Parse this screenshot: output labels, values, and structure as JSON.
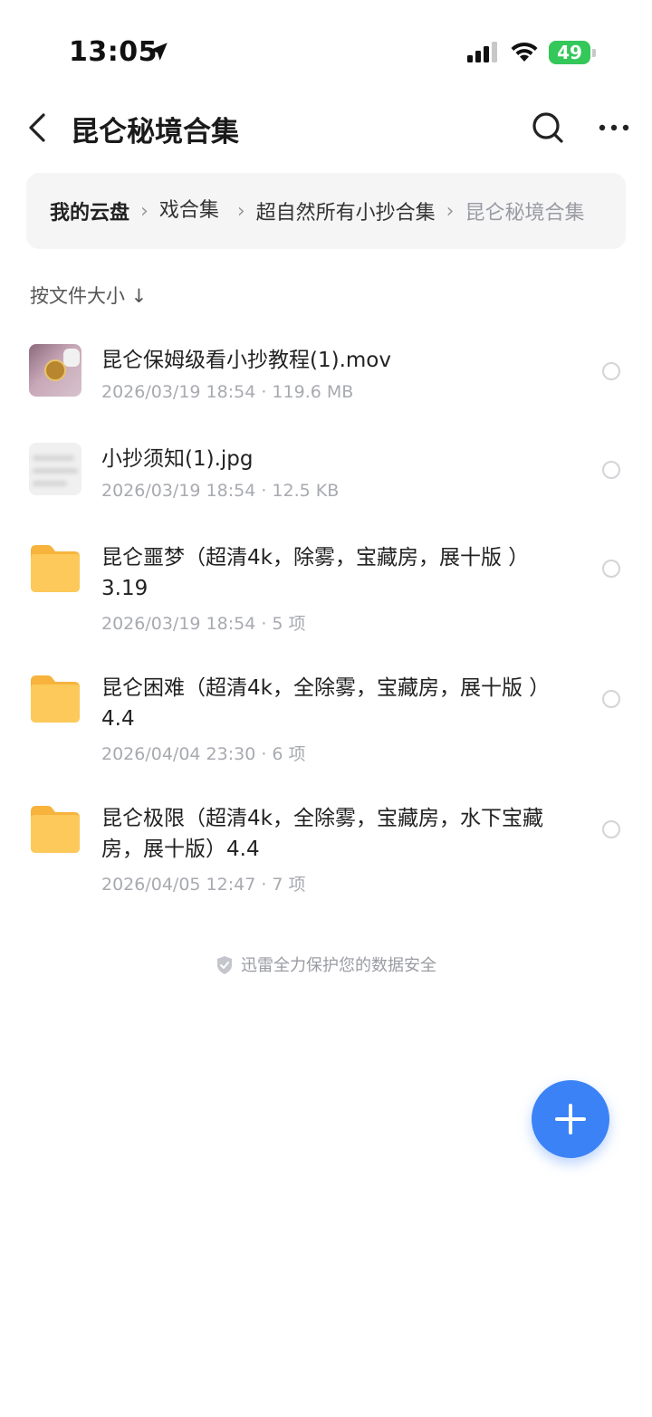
{
  "status_bar": {
    "time": "13:05",
    "battery": "49"
  },
  "header": {
    "title": "昆仑秘境合集"
  },
  "breadcrumb": {
    "items": [
      "我的云盘",
      "戏合集",
      "超自然所有小抄合集",
      "昆仑秘境合集"
    ]
  },
  "sort": {
    "label": "按文件大小 ↓"
  },
  "files": [
    {
      "name": "昆仑保姆级看小抄教程(1).mov",
      "meta": "2026/03/19 18:54 · 119.6 MB",
      "type": "video"
    },
    {
      "name": "小抄须知(1).jpg",
      "meta": "2026/03/19 18:54 · 12.5 KB",
      "type": "image"
    },
    {
      "name": "昆仑噩梦（超清4k，除雾，宝藏房，展十版 ）3.19",
      "meta": "2026/03/19 18:54 · 5 项",
      "type": "folder"
    },
    {
      "name": "昆仑困难（超清4k，全除雾，宝藏房，展十版 ）4.4",
      "meta": "2026/04/04 23:30 · 6 项",
      "type": "folder"
    },
    {
      "name": "昆仑极限（超清4k，全除雾，宝藏房，水下宝藏房，展十版）4.4",
      "meta": "2026/04/05 12:47 · 7 项",
      "type": "folder"
    }
  ],
  "footer": {
    "security_note": "迅雷全力保护您的数据安全"
  },
  "colors": {
    "accent": "#3b82f6",
    "folder": "#fbbf4a",
    "battery": "#34c759"
  }
}
